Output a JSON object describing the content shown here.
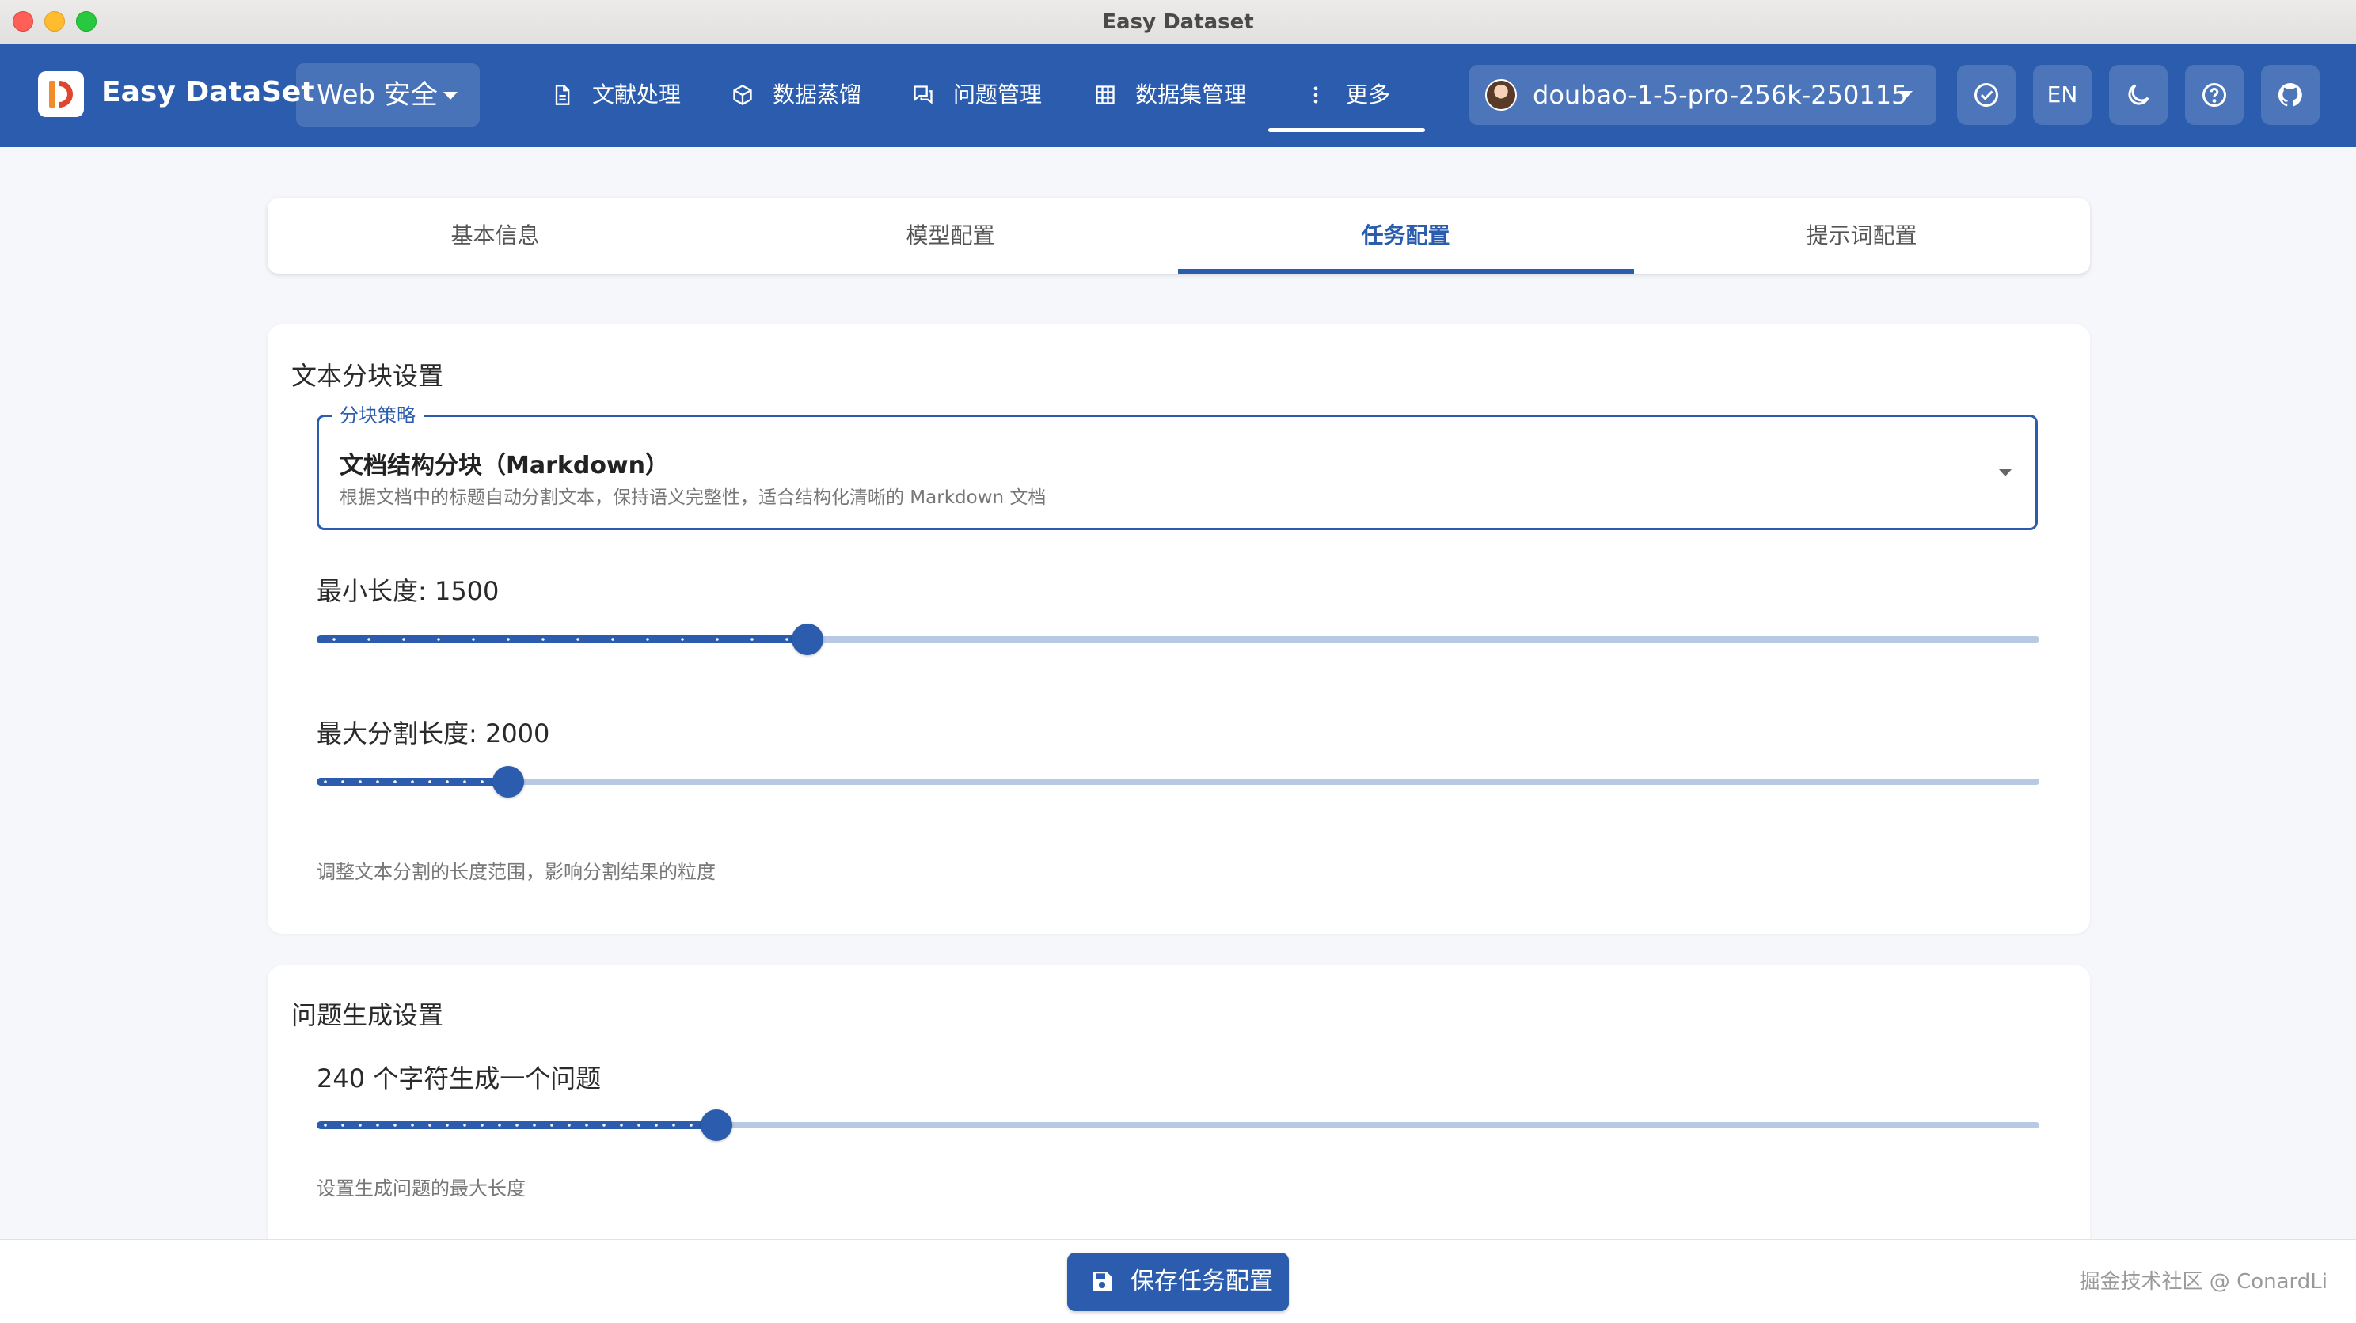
{
  "window": {
    "title": "Easy Dataset"
  },
  "header": {
    "app_name": "Easy DataSet",
    "project": "Web 安全",
    "nav": [
      {
        "label": "文献处理",
        "icon": "document-icon"
      },
      {
        "label": "数据蒸馏",
        "icon": "cube-icon"
      },
      {
        "label": "问题管理",
        "icon": "chat-icon"
      },
      {
        "label": "数据集管理",
        "icon": "grid-icon"
      },
      {
        "label": "更多",
        "icon": "more-vertical-icon"
      }
    ],
    "active_nav": "更多",
    "model": "doubao-1-5-pro-256k-250115",
    "language": "EN",
    "accent": "#2b5cad"
  },
  "tabs": [
    {
      "label": "基本信息"
    },
    {
      "label": "模型配置"
    },
    {
      "label": "任务配置"
    },
    {
      "label": "提示词配置"
    }
  ],
  "active_tab": "任务配置",
  "text_split": {
    "title": "文本分块设置",
    "strategy": {
      "legend": "分块策略",
      "value": "文档结构分块（Markdown）",
      "description": "根据文档中的标题自动分割文本，保持语义完整性，适合结构化清晰的 Markdown 文档"
    },
    "min_length": {
      "label": "最小长度: 1500",
      "fraction": 0.285
    },
    "max_length": {
      "label": "最大分割长度: 2000",
      "fraction": 0.111
    },
    "helper": "调整文本分割的长度范围，影响分割结果的粒度"
  },
  "question_gen": {
    "title": "问题生成设置",
    "slider": {
      "label": "240 个字符生成一个问题",
      "fraction": 0.232
    },
    "helper": "设置生成问题的最大长度"
  },
  "footer": {
    "save_label": "保存任务配置",
    "watermark": "掘金技术社区 @ ConardLi"
  }
}
